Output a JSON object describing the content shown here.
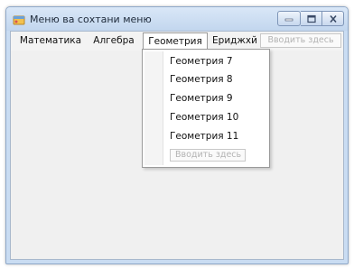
{
  "window": {
    "title": "Меню ва сохтани меню"
  },
  "menubar": {
    "items": [
      {
        "label": "Математика"
      },
      {
        "label": "Алгебра"
      },
      {
        "label": "Геометрия",
        "open": true
      },
      {
        "label": "Ериджхй"
      }
    ],
    "add_placeholder": "Вводить здесь"
  },
  "dropdown": {
    "items": [
      {
        "label": "Геометрия 7"
      },
      {
        "label": "Геометрия 8"
      },
      {
        "label": "Геометрия 9"
      },
      {
        "label": "Геометрия 10"
      },
      {
        "label": "Геометрия 11"
      }
    ],
    "add_placeholder": "Вводить здесь"
  },
  "colors": {
    "titlebar": "#c9dcf2",
    "client": "#f0f0f0",
    "placeholder_text": "#b3b3b3"
  },
  "icons": {
    "app": "form-icon",
    "minimize": "minimize-icon",
    "maximize": "maximize-icon",
    "close": "close-icon"
  }
}
